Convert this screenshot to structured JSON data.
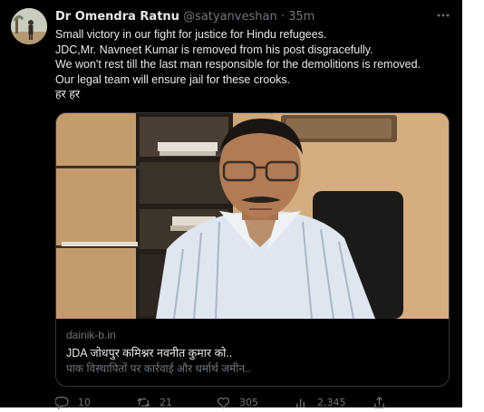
{
  "tweet": {
    "author_name": "Dr Omendra Ratnu",
    "handle": "@satyanveshan",
    "separator": "·",
    "time": "35m",
    "text_lines": [
      "Small victory in our fight for justice for Hindu refugees.",
      "JDC,Mr. Navneet Kumar is removed from his post disgracefully.",
      "We won't rest till the last man responsible for the demolitions  is removed.",
      "Our legal team will ensure jail for these crooks.",
      "हर हर"
    ]
  },
  "link_card": {
    "domain": "dainik-b.in",
    "title": "JDA जोधपुर कमिश्नर नवनीत कुमार को..",
    "description": "पाक विस्थापितों पर कार्रवाई और धर्मार्थ जमीन..",
    "image": "news-photo-official-at-desk"
  },
  "actions": {
    "reply_count": "10",
    "retweet_count": "21",
    "like_count": "305",
    "views_count": "2,345"
  },
  "colors": {
    "background": "#000000",
    "text": "#e7e9ea",
    "muted": "#71767b",
    "border": "#333639"
  }
}
